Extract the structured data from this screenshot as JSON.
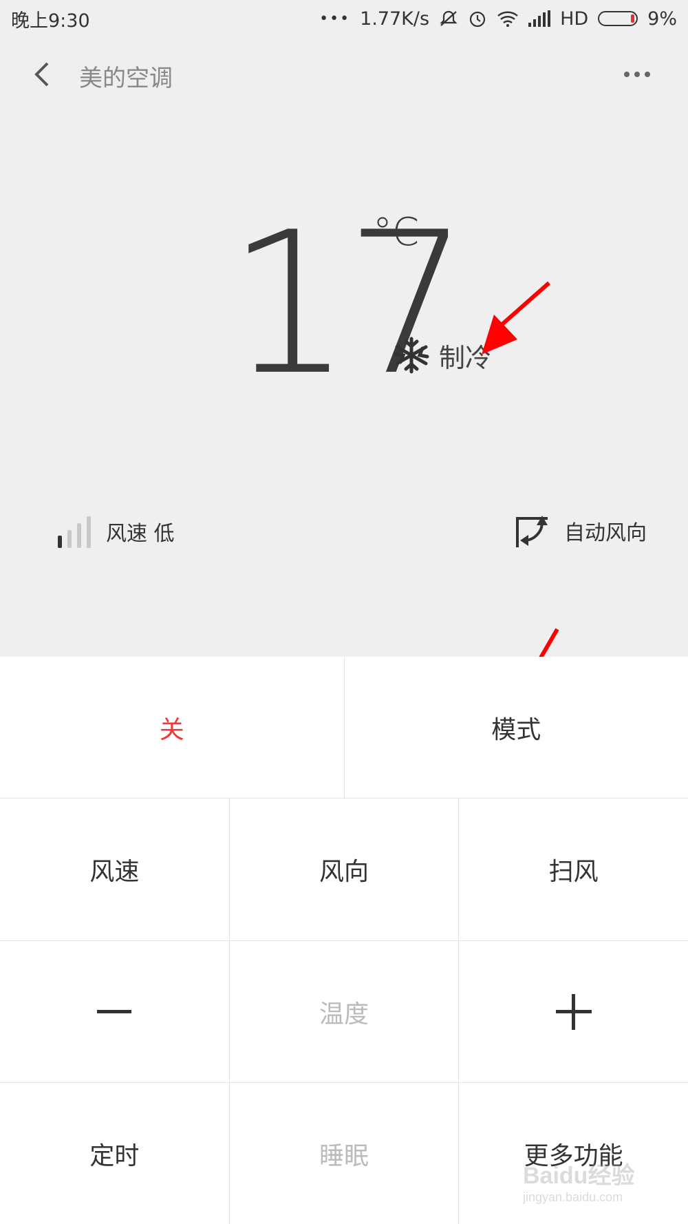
{
  "status_bar": {
    "time": "晚上9:30",
    "dots": "•••",
    "net_speed": "1.77K/s",
    "network": "HD",
    "battery": "9%"
  },
  "header": {
    "title": "美的空调"
  },
  "display": {
    "temperature": "17",
    "unit": "°C",
    "mode": "制冷"
  },
  "status_row": {
    "fan_speed": "风速 低",
    "fan_level_fraction": 0.25,
    "direction": "自动风向"
  },
  "controls": {
    "row1": {
      "power": "关",
      "mode": "模式"
    },
    "row2": {
      "fan_speed": "风速",
      "direction": "风向",
      "swing": "扫风"
    },
    "row3": {
      "label": "温度"
    },
    "row4": {
      "timer": "定时",
      "sleep": "睡眠",
      "more": "更多功能"
    }
  },
  "watermark": {
    "brand": "Baidu经验",
    "url": "jingyan.baidu.com"
  },
  "colors": {
    "background": "#efefef",
    "panel": "#ffffff",
    "power_off": "#f0373b",
    "disabled": "#bbbbbb",
    "annotation_arrow": "#ff0000",
    "battery_low": "#e03030"
  },
  "icons": {
    "back": "back-arrow-icon",
    "more": "more-dots-icon",
    "mode": "snowflake-icon",
    "fan": "signal-bars-icon",
    "direction": "rotate-arrow-icon",
    "minus": "minus-icon",
    "plus": "plus-icon"
  }
}
